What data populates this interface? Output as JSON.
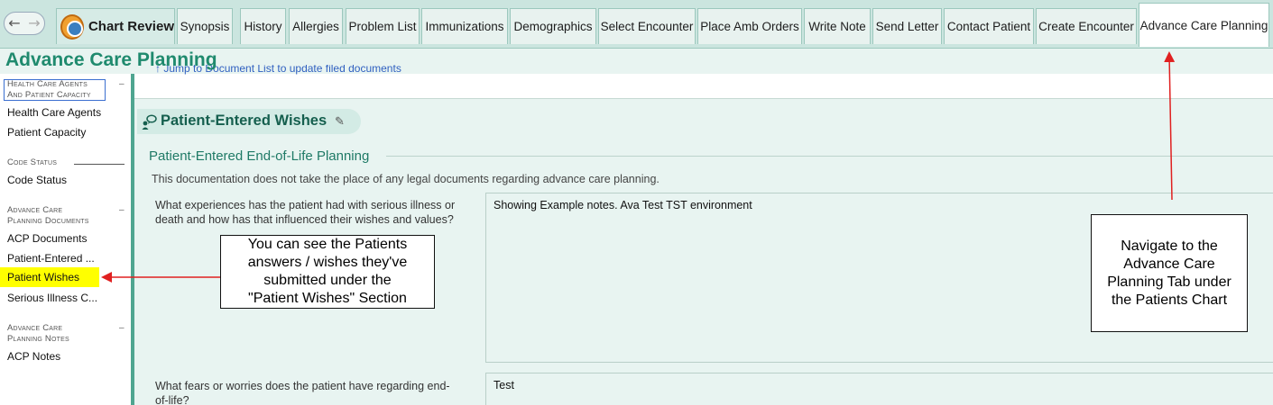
{
  "nav": {
    "back_icon": "back-arrow-icon",
    "forward_icon": "forward-arrow-icon"
  },
  "tabs": [
    {
      "label": "Chart Review"
    },
    {
      "label": "Synopsis"
    },
    {
      "label": "History"
    },
    {
      "label": "Allergies"
    },
    {
      "label": "Problem List"
    },
    {
      "label": "Immunizations"
    },
    {
      "label": "Demographics"
    },
    {
      "label": "Select Encounter"
    },
    {
      "label": "Place Amb Orders"
    },
    {
      "label": "Write Note"
    },
    {
      "label": "Send Letter"
    },
    {
      "label": "Contact Patient"
    },
    {
      "label": "Create Encounter"
    },
    {
      "label": "Advance Care Planning"
    }
  ],
  "page": {
    "title": "Advance Care Planning"
  },
  "sidebar": {
    "sections": [
      {
        "title_line1": "Health Care Agents",
        "title_line2": "And Patient Capacity",
        "collapse": "–",
        "items": [
          "Health Care Agents",
          "Patient Capacity"
        ]
      },
      {
        "title_line1": "Code Status",
        "title_line2": "",
        "collapse": "",
        "items": [
          "Code Status"
        ]
      },
      {
        "title_line1": "Advance Care",
        "title_line2": "Planning Documents",
        "collapse": "–",
        "items": [
          "ACP Documents",
          "Patient-Entered ...",
          "Patient Wishes",
          "Serious Illness C..."
        ]
      },
      {
        "title_line1": "Advance Care",
        "title_line2": "Planning Notes",
        "collapse": "–",
        "items": [
          "ACP Notes"
        ]
      }
    ]
  },
  "main": {
    "jump_link": "↑ Jump to Document List to update filed documents",
    "section_title": "Patient-Entered Wishes",
    "subsection_title": "Patient-Entered End-of-Life Planning",
    "disclaimer": "This documentation does not take the place of any legal documents regarding advance care planning.",
    "questions": [
      {
        "q_line1": "What experiences has the patient had with serious illness or",
        "q_line2": "death and how has that influenced their wishes and values?",
        "answer": "Showing Example notes. Ava Test TST environment"
      },
      {
        "q_line1": "What fears or worries does the patient have regarding end-",
        "q_line2": "of-life?",
        "answer": "Test"
      }
    ]
  },
  "annotations": {
    "callout_left": [
      "You can see the Patients",
      "answers / wishes they've",
      "submitted under the",
      "\"Patient Wishes\" Section"
    ],
    "callout_right": [
      "Navigate to the",
      "Advance Care",
      "Planning Tab under",
      "the Patients Chart"
    ],
    "arrow_color": "#e02020"
  },
  "colors": {
    "accent": "#1f8a6e",
    "tab_bg": "#cbe5df",
    "highlight": "#ffff00"
  }
}
